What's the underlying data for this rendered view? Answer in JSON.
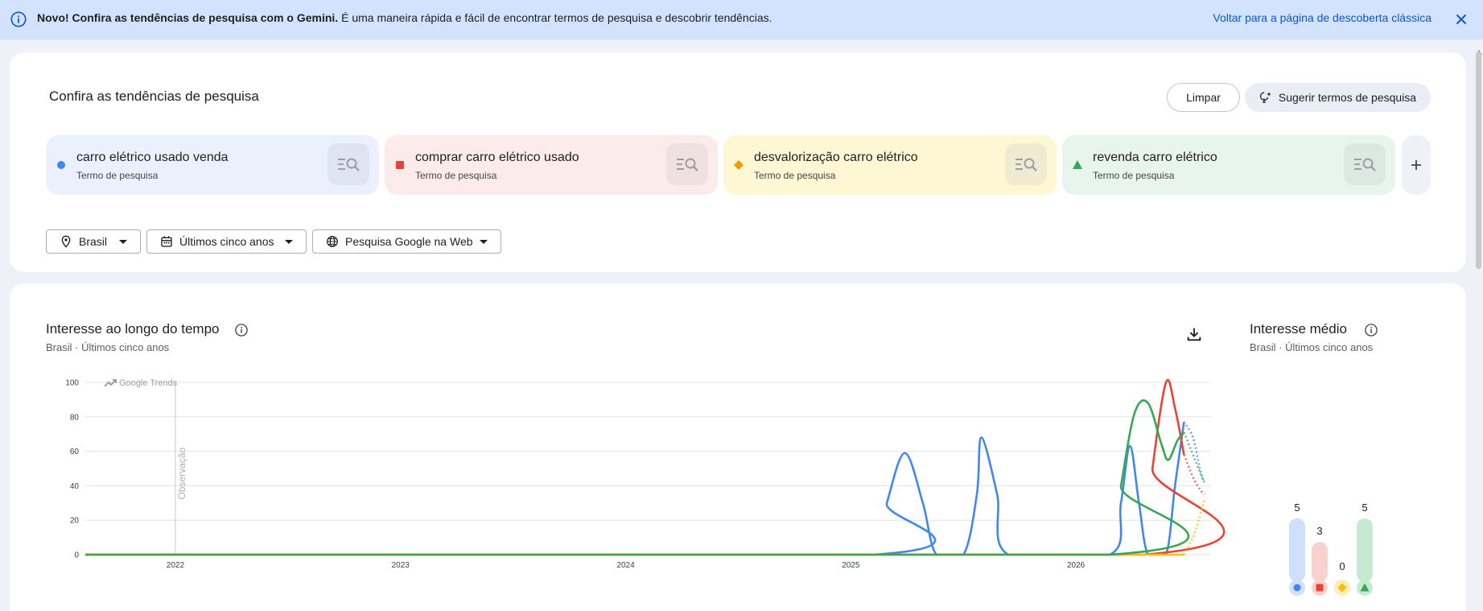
{
  "banner": {
    "bold": "Novo! Confira as tendências de pesquisa com o Gemini.",
    "text": "É uma maneira rápida e fácil de encontrar termos de pesquisa e descobrir tendências.",
    "link": "Voltar para a página de descoberta clássica"
  },
  "explore": {
    "title": "Confira as tendências de pesquisa",
    "clear_label": "Limpar",
    "suggest_label": "Sugerir termos de pesquisa"
  },
  "terms": [
    {
      "name": "carro elétrico usado venda",
      "type": "Termo de pesquisa",
      "color": "#4285f4",
      "bg": "#ebf1fc",
      "btn": "#dde5f2",
      "shape": "circle"
    },
    {
      "name": "comprar carro elétrico usado",
      "type": "Termo de pesquisa",
      "color": "#ea4335",
      "bg": "#fcebeb",
      "btn": "#f0e1e1",
      "shape": "square"
    },
    {
      "name": "desvalorização carro elétrico",
      "type": "Termo de pesquisa",
      "color": "#f29900",
      "bg": "#fef7d3",
      "btn": "#f0ead0",
      "shape": "diamond"
    },
    {
      "name": "revenda carro elétrico",
      "type": "Termo de pesquisa",
      "color": "#34a853",
      "bg": "#e8f5ec",
      "btn": "#dce9e0",
      "shape": "triangle"
    }
  ],
  "filters": {
    "location": "Brasil",
    "period": "Últimos cinco anos",
    "source": "Pesquisa Google na Web"
  },
  "interest_over_time": {
    "title": "Interesse ao longo do tempo",
    "location": "Brasil",
    "period": "Últimos cinco anos",
    "watermark": "Google Trends",
    "note": "Observação"
  },
  "avg_interest": {
    "title": "Interesse médio",
    "location": "Brasil",
    "period": "Últimos cinco anos"
  },
  "chart_data": [
    {
      "type": "line",
      "ylim": [
        0,
        100
      ],
      "yticks": [
        0,
        20,
        40,
        60,
        80,
        100
      ],
      "xticks": [
        "2022",
        "2023",
        "2024",
        "2025",
        "2026"
      ],
      "x_domain": [
        2021.6,
        2026.6
      ],
      "series": [
        {
          "name": "carro elétrico usado venda",
          "color": "#4285f4",
          "points": [
            [
              2021.6,
              0
            ],
            [
              2025.1,
              0
            ],
            [
              2025.16,
              30
            ],
            [
              2025.24,
              59
            ],
            [
              2025.32,
              30
            ],
            [
              2025.38,
              0
            ],
            [
              2025.5,
              0
            ],
            [
              2025.56,
              35
            ],
            [
              2025.58,
              68
            ],
            [
              2025.65,
              35
            ],
            [
              2025.7,
              0
            ],
            [
              2026.15,
              0
            ],
            [
              2026.2,
              30
            ],
            [
              2026.24,
              63
            ],
            [
              2026.28,
              30
            ],
            [
              2026.32,
              0
            ],
            [
              2026.4,
              0
            ],
            [
              2026.44,
              40
            ],
            [
              2026.48,
              77
            ]
          ],
          "partial": [
            [
              2026.48,
              77
            ],
            [
              2026.52,
              68
            ],
            [
              2026.55,
              50
            ],
            [
              2026.57,
              42
            ]
          ]
        },
        {
          "name": "comprar carro elétrico usado",
          "color": "#ea4335",
          "points": [
            [
              2021.6,
              0
            ],
            [
              2026.3,
              0
            ],
            [
              2026.34,
              50
            ],
            [
              2026.4,
              100
            ],
            [
              2026.44,
              85
            ],
            [
              2026.48,
              58
            ]
          ],
          "partial": [
            [
              2026.48,
              58
            ],
            [
              2026.52,
              45
            ],
            [
              2026.55,
              38
            ],
            [
              2026.57,
              35
            ]
          ]
        },
        {
          "name": "desvalorização carro elétrico",
          "color": "#fbbc04",
          "points": [
            [
              2021.6,
              0
            ],
            [
              2026.48,
              0
            ]
          ],
          "partial": [
            [
              2026.48,
              0
            ],
            [
              2026.52,
              10
            ],
            [
              2026.55,
              22
            ],
            [
              2026.57,
              32
            ]
          ]
        },
        {
          "name": "revenda carro elétrico",
          "color": "#34a853",
          "points": [
            [
              2021.6,
              0
            ],
            [
              2026.15,
              0
            ],
            [
              2026.2,
              40
            ],
            [
              2026.26,
              82
            ],
            [
              2026.32,
              88
            ],
            [
              2026.38,
              64
            ],
            [
              2026.41,
              55
            ],
            [
              2026.45,
              66
            ],
            [
              2026.48,
              71
            ]
          ],
          "partial": [
            [
              2026.48,
              71
            ],
            [
              2026.52,
              58
            ],
            [
              2026.55,
              48
            ],
            [
              2026.57,
              42
            ]
          ]
        }
      ]
    },
    {
      "type": "bar",
      "categories": [
        "carro elétrico usado venda",
        "comprar carro elétrico usado",
        "desvalorização carro elétrico",
        "revenda carro elétrico"
      ],
      "values": [
        5,
        3,
        0,
        5
      ],
      "colors": [
        "#4285f4",
        "#ea4335",
        "#fbbc04",
        "#34a853"
      ],
      "light_colors": [
        "#cfe0fb",
        "#f8d2cf",
        "#feeeb6",
        "#c6ead1"
      ],
      "shapes": [
        "circle",
        "square",
        "diamond",
        "triangle"
      ],
      "ylim": [
        0,
        5
      ]
    }
  ]
}
